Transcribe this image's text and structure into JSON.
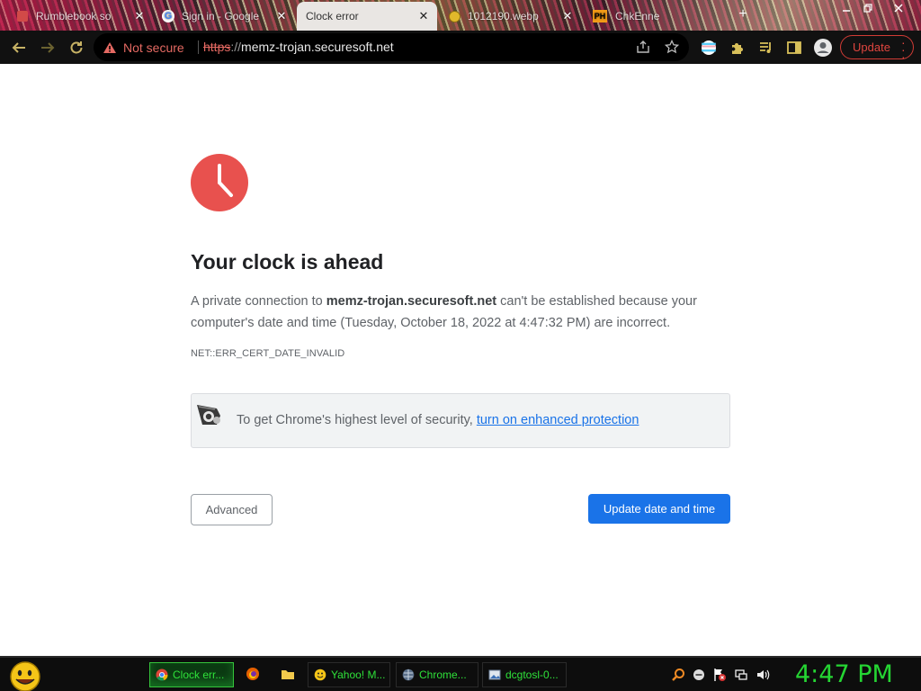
{
  "browser": {
    "tabs": [
      {
        "title": "Rumblebook so",
        "icon": "doc-icon"
      },
      {
        "title": "Sign in - Google",
        "icon": "google-icon"
      },
      {
        "title": "Clock error",
        "icon": "none",
        "active": true
      },
      {
        "title": "1012190.webp",
        "icon": "coin-icon"
      },
      {
        "title": "ChkEnne",
        "icon": "ph-icon"
      }
    ],
    "toolbar": {
      "security_label": "Not secure",
      "url_scheme": "https",
      "url_separator": "://",
      "url_host": "memz-trojan.securesoft.net",
      "update_label": "Update"
    }
  },
  "page": {
    "title": "Your clock is ahead",
    "message_prefix": "A private connection to ",
    "message_host": "memz-trojan.securesoft.net",
    "message_suffix": " can't be established because your computer's date and time (Tuesday, October 18, 2022 at 4:47:32 PM) are incorrect.",
    "error_code": "NET::ERR_CERT_DATE_INVALID",
    "enhanced_text": "To get Chrome's highest level of security, ",
    "enhanced_link": "turn on enhanced protection",
    "advanced_button": "Advanced",
    "primary_button": "Update date and time"
  },
  "taskbar": {
    "tasks": [
      {
        "label": "Clock err...",
        "icon": "chrome-icon",
        "active": true
      },
      {
        "label": "Yahoo! M...",
        "icon": "smiley-icon"
      },
      {
        "label": "Chrome...",
        "icon": "globe-icon"
      },
      {
        "label": "dcgtosl-0...",
        "icon": "image-icon"
      }
    ],
    "clock": "4:47 PM"
  },
  "colors": {
    "accent": "#1a73e8",
    "error_red": "#e46962",
    "clock_icon": "#e53935",
    "taskbar_green": "#25d633"
  }
}
